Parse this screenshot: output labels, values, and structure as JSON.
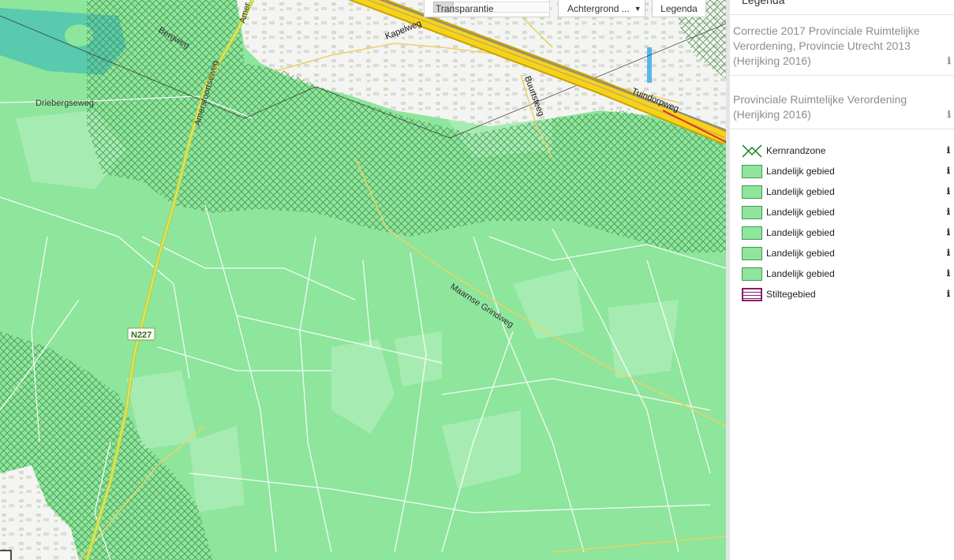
{
  "toolbar": {
    "transparency_label": "Transparantie",
    "background_label": "Achtergrond ...",
    "background_caret": "▼",
    "legend_label": "Legenda"
  },
  "map": {
    "street_labels": {
      "bergweg": "Bergweg",
      "driebergseweg": "Driebergseweg",
      "amersfoortseweg": "Amersfoortseweg",
      "amersfoortseweg_top": "Amer",
      "kapelweg": "Kapelweg",
      "buurtsteeg": "Buurtsteeg",
      "tuindorpweg": "Tuindorpweg",
      "maarnse_grindweg": "Maarnse Grindweg"
    },
    "road_shield": "N227",
    "colors": {
      "rural_area": "#8ee59c",
      "hatch": "#3d8a48",
      "urban": "#f4f4f2",
      "motorway": "#f6d21c",
      "water": "#4cc3b3"
    }
  },
  "legend": {
    "title": "Legenda",
    "layer_groups": [
      {
        "title": "Correctie 2017 Provinciale Ruimtelijke Verordening, Provincie Utrecht 2013 (Herijking 2016)",
        "info": "ℹ"
      },
      {
        "title": "Provinciale Ruimtelijke Verordening (Herijking 2016)",
        "info": "ℹ"
      }
    ],
    "items": [
      {
        "label": "Kernrandzone",
        "swatch": "kernrandzone",
        "info": "ℹ"
      },
      {
        "label": "Landelijk gebied",
        "swatch": "green",
        "info": "ℹ"
      },
      {
        "label": "Landelijk gebied",
        "swatch": "green",
        "info": "ℹ"
      },
      {
        "label": "Landelijk gebied",
        "swatch": "green",
        "info": "ℹ"
      },
      {
        "label": "Landelijk gebied",
        "swatch": "green",
        "info": "ℹ"
      },
      {
        "label": "Landelijk gebied",
        "swatch": "green",
        "info": "ℹ"
      },
      {
        "label": "Landelijk gebied",
        "swatch": "green",
        "info": "ℹ"
      },
      {
        "label": "Stiltegebied",
        "swatch": "stiltegebied",
        "info": "ℹ"
      }
    ]
  }
}
